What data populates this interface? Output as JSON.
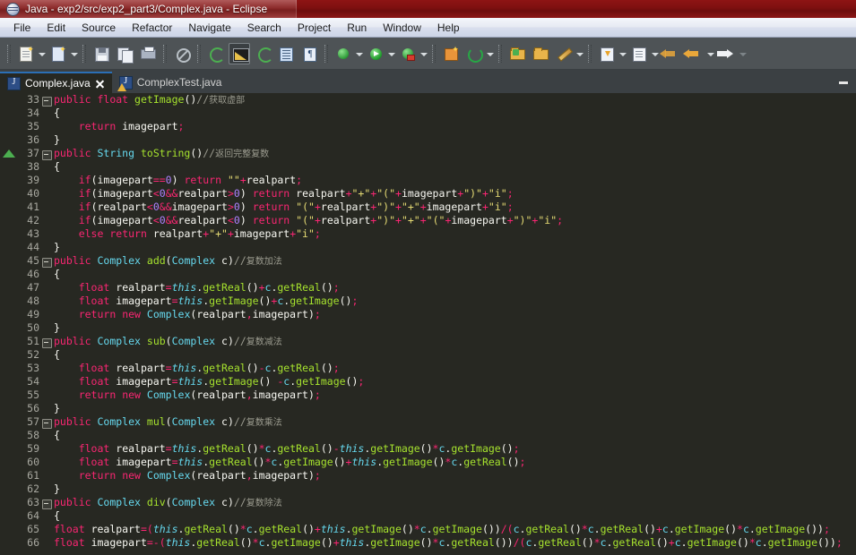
{
  "window": {
    "title": "Java - exp2/src/exp2_part3/Complex.java - Eclipse",
    "app_icon": "eclipse-icon"
  },
  "menubar": {
    "items": [
      {
        "label": "File"
      },
      {
        "label": "Edit"
      },
      {
        "label": "Source"
      },
      {
        "label": "Refactor"
      },
      {
        "label": "Navigate"
      },
      {
        "label": "Search"
      },
      {
        "label": "Project"
      },
      {
        "label": "Run"
      },
      {
        "label": "Window"
      },
      {
        "label": "Help"
      }
    ]
  },
  "toolbar": {
    "buttons": [
      {
        "name": "new-wizard-icon"
      },
      {
        "name": "new-java-class-icon"
      },
      {
        "name": "save-icon"
      },
      {
        "name": "save-all-icon"
      },
      {
        "name": "print-icon"
      },
      {
        "name": "toggle-breadcrumb-icon"
      },
      {
        "name": "open-type-icon"
      },
      {
        "name": "search-icon"
      },
      {
        "name": "next-annotation-icon"
      },
      {
        "name": "open-task-icon"
      },
      {
        "name": "pilcrow-icon"
      },
      {
        "name": "debug-icon"
      },
      {
        "name": "run-icon"
      },
      {
        "name": "run-external-tools-icon"
      },
      {
        "name": "new-java-project-icon"
      },
      {
        "name": "refresh-icon"
      },
      {
        "name": "open-folder-green-icon"
      },
      {
        "name": "open-folder-icon"
      },
      {
        "name": "edit-pencil-icon"
      },
      {
        "name": "download-icon"
      },
      {
        "name": "task-list-icon"
      },
      {
        "name": "back-pale-icon"
      },
      {
        "name": "back-icon"
      },
      {
        "name": "forward-icon"
      }
    ]
  },
  "tabs": {
    "items": [
      {
        "label": "Complex.java",
        "active": true,
        "closable": true,
        "icon": "java-file-icon"
      },
      {
        "label": "ComplexTest.java",
        "active": false,
        "closable": false,
        "icon": "java-file-warning-icon"
      }
    ],
    "minimize_label": "minimize-icon"
  },
  "editor": {
    "file": "Complex.java",
    "first_line": 33,
    "last_line": 66,
    "lines": [
      {
        "n": 33,
        "fold": true,
        "ovr": false
      },
      {
        "n": 34,
        "fold": false,
        "ovr": false
      },
      {
        "n": 35,
        "fold": false,
        "ovr": false
      },
      {
        "n": 36,
        "fold": false,
        "ovr": false
      },
      {
        "n": 37,
        "fold": true,
        "ovr": true
      },
      {
        "n": 38,
        "fold": false,
        "ovr": false
      },
      {
        "n": 39,
        "fold": false,
        "ovr": false
      },
      {
        "n": 40,
        "fold": false,
        "ovr": false
      },
      {
        "n": 41,
        "fold": false,
        "ovr": false
      },
      {
        "n": 42,
        "fold": false,
        "ovr": false
      },
      {
        "n": 43,
        "fold": false,
        "ovr": false
      },
      {
        "n": 44,
        "fold": false,
        "ovr": false
      },
      {
        "n": 45,
        "fold": true,
        "ovr": false
      },
      {
        "n": 46,
        "fold": false,
        "ovr": false
      },
      {
        "n": 47,
        "fold": false,
        "ovr": false
      },
      {
        "n": 48,
        "fold": false,
        "ovr": false
      },
      {
        "n": 49,
        "fold": false,
        "ovr": false
      },
      {
        "n": 50,
        "fold": false,
        "ovr": false
      },
      {
        "n": 51,
        "fold": true,
        "ovr": false
      },
      {
        "n": 52,
        "fold": false,
        "ovr": false
      },
      {
        "n": 53,
        "fold": false,
        "ovr": false
      },
      {
        "n": 54,
        "fold": false,
        "ovr": false
      },
      {
        "n": 55,
        "fold": false,
        "ovr": false
      },
      {
        "n": 56,
        "fold": false,
        "ovr": false
      },
      {
        "n": 57,
        "fold": true,
        "ovr": false
      },
      {
        "n": 58,
        "fold": false,
        "ovr": false
      },
      {
        "n": 59,
        "fold": false,
        "ovr": false
      },
      {
        "n": 60,
        "fold": false,
        "ovr": false
      },
      {
        "n": 61,
        "fold": false,
        "ovr": false
      },
      {
        "n": 62,
        "fold": false,
        "ovr": false
      },
      {
        "n": 63,
        "fold": true,
        "ovr": false
      },
      {
        "n": 64,
        "fold": false,
        "ovr": false
      },
      {
        "n": 65,
        "fold": false,
        "ovr": false
      },
      {
        "n": 66,
        "fold": false,
        "ovr": false
      }
    ],
    "source": [
      "public float getImage()//获取虚部",
      "{",
      "    return imagepart;",
      "}",
      "public String toString()//返回完整复数",
      "{",
      "    if(imagepart==0) return \"\"+realpart;",
      "    if(imagepart<0&&realpart>0) return realpart+\"+\"+\"(\"+imagepart+\")\"+\"i\";",
      "    if(realpart<0&&imagepart>0) return \"(\"+realpart+\")\"+\"+\"+imagepart+\"i\";",
      "    if(imagepart<0&&realpart<0) return \"(\"+realpart+\")\"+\"+\"+\"(\"+imagepart+\")\"+\"i\";",
      "    else return realpart+\"+\"+imagepart+\"i\";",
      "}",
      "public Complex add(Complex c)//复数加法",
      "{",
      "    float realpart=this.getReal()+c.getReal();",
      "    float imagepart=this.getImage()+c.getImage();",
      "    return new Complex(realpart,imagepart);",
      "}",
      "public Complex sub(Complex c)//复数减法",
      "{",
      "    float realpart=this.getReal()-c.getReal();",
      "    float imagepart=this.getImage()-c.getImage();",
      "    return new Complex(realpart,imagepart);",
      "}",
      "public Complex mul(Complex c)//复数乘法",
      "{",
      "    float realpart=this.getReal()*c.getReal()-this.getImage()*c.getImage();",
      "    float imagepart=this.getReal()*c.getImage()+this.getImage()*c.getReal();",
      "    return new Complex(realpart,imagepart);",
      "}",
      "public Complex div(Complex c)//复数除法",
      "{",
      "float realpart=(this.getReal()*c.getReal()+this.getImage()*c.getImage())/(c.getReal()*c.getReal()+c.getImage()*c.getImage());",
      "float imagepart=-(this.getReal()*c.getImage()+this.getImage()*c.getReal())/(c.getReal()*c.getReal()+c.getImage()*c.getImage());"
    ]
  },
  "colors": {
    "titlebar": "#7d1010",
    "menubar": "#e6eaf3",
    "toolbar": "#4e5356",
    "tabbar": "#3b4043",
    "editor_bg": "#272822",
    "keyword": "#f92672",
    "type": "#66d9ef",
    "method": "#a6e22e",
    "string": "#e6db74",
    "number": "#ae81ff",
    "comment": "#9b9b8f",
    "linenumber": "#a8a8a0",
    "active_tab_accent": "#2b6fb5"
  }
}
